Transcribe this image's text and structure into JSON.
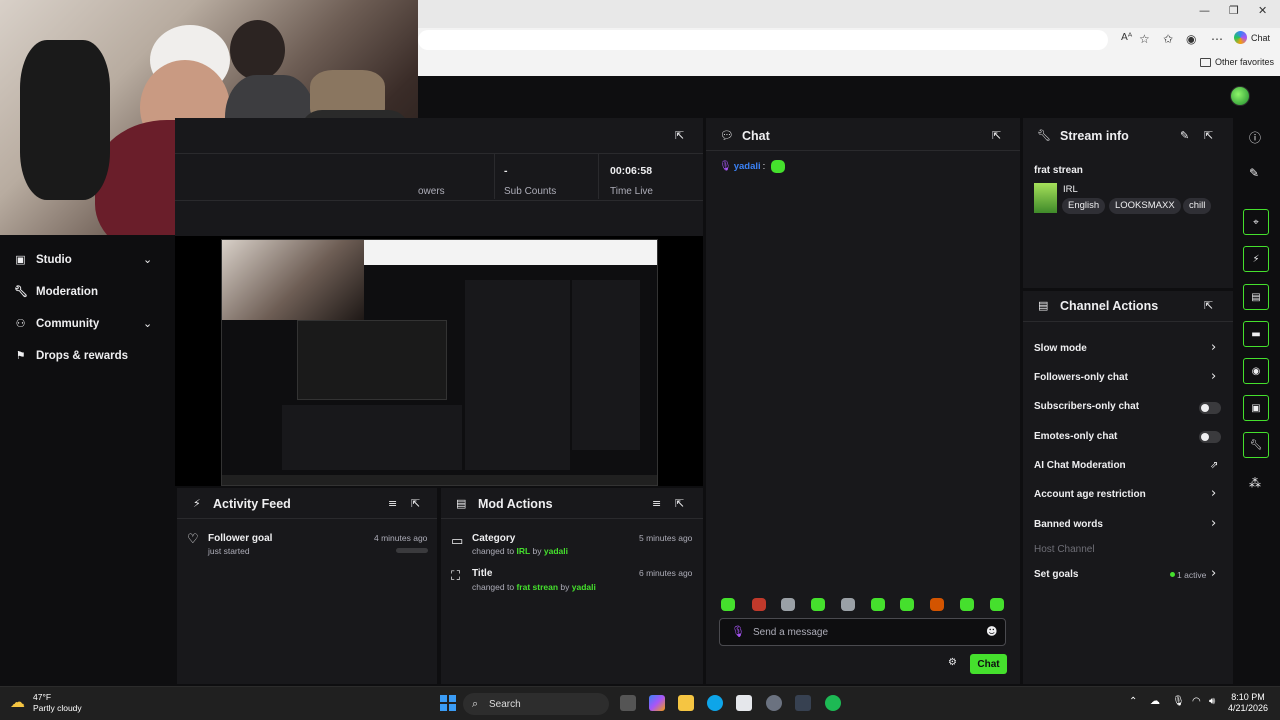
{
  "browser": {
    "chat_label": "Chat",
    "favorites_label": "Other favorites",
    "read_aloud_label": "Aᴬ",
    "window_controls": [
      "—",
      "❐",
      "✕"
    ]
  },
  "sidebar": {
    "items": [
      {
        "label": "Studio",
        "icon": "studio-icon",
        "has_chevron": true
      },
      {
        "label": "Moderation",
        "icon": "wrench-icon",
        "has_chevron": false
      },
      {
        "label": "Community",
        "icon": "community-icon",
        "has_chevron": true
      },
      {
        "label": "Drops & rewards",
        "icon": "drops-icon",
        "has_chevron": false
      }
    ]
  },
  "stats": {
    "followers_label": "owers",
    "subs_value": "-",
    "subs_label": "Sub Counts",
    "time_value": "00:06:58",
    "time_label": "Time Live"
  },
  "chat": {
    "title": "Chat",
    "message_user": "yadali",
    "message_sep": ":",
    "placeholder": "Send a message",
    "send_label": "Chat"
  },
  "activity_feed": {
    "title": "Activity Feed",
    "items": [
      {
        "title": "Follower goal",
        "subtitle": "just started",
        "time": "4 minutes ago"
      }
    ]
  },
  "mod_actions": {
    "title": "Mod Actions",
    "items": [
      {
        "title": "Category",
        "prefix": "changed to",
        "value": "IRL",
        "by": "by",
        "user": "yadali",
        "time": "5 minutes ago"
      },
      {
        "title": "Title",
        "prefix": "changed to",
        "value": "frat strean",
        "by": "by",
        "user": "yadali",
        "time": "6 minutes ago"
      }
    ]
  },
  "stream_info": {
    "title": "Stream info",
    "stream_title": "frat strean",
    "category": "IRL",
    "tags": [
      "English",
      "LOOKSMAXX",
      "chill"
    ]
  },
  "channel_actions": {
    "title": "Channel Actions",
    "items": [
      {
        "label": "Slow mode"
      },
      {
        "label": "Followers-only chat"
      },
      {
        "label": "Subscribers-only chat"
      },
      {
        "label": "Emotes-only chat"
      },
      {
        "label": "AI Chat Moderation"
      },
      {
        "label": "Account age restriction"
      },
      {
        "label": "Banned words"
      },
      {
        "label": "Host Channel"
      },
      {
        "label": "Set goals"
      }
    ],
    "goals_status": "1 active"
  },
  "taskbar": {
    "weather_temp": "47°F",
    "weather_desc": "Partly cloudy",
    "search_label": "Search",
    "time": "8:10 PM",
    "date": "4/21/2026"
  },
  "colors": {
    "accent": "#45e02d",
    "panel": "#18181b",
    "background": "#0e0e10",
    "username": "#3b82f6"
  }
}
